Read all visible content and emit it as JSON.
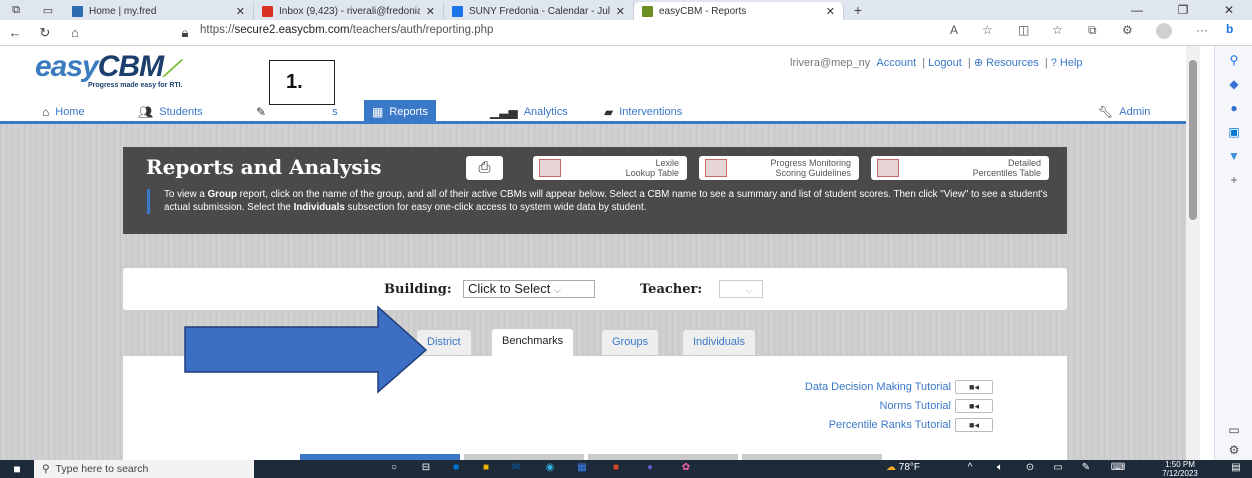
{
  "browser": {
    "tabs": [
      {
        "label": "Home | my.fred",
        "favicon_color": "#2b6cb0"
      },
      {
        "label": "Inbox (9,423) - riverali@fredonia",
        "favicon_color": "#d93025"
      },
      {
        "label": "SUNY Fredonia - Calendar - July",
        "favicon_color": "#1a73e8"
      },
      {
        "label": "easyCBM - Reports",
        "favicon_color": "#6b8e23",
        "active": true
      }
    ],
    "url_prefix": "https://",
    "url_domain": "secure2.easycbm.com",
    "url_path": "/teachers/auth/reporting.php"
  },
  "site": {
    "logo_easy": "easy",
    "logo_cbm": "CBM",
    "tagline": "Progress made easy for RTI.",
    "annotation": "1.",
    "user": "lrivera@mep_ny",
    "links": [
      "Account",
      "Logout",
      "Resources",
      "Help"
    ],
    "nav": [
      {
        "label": "Home",
        "icon": "home-icon"
      },
      {
        "label": "Students",
        "icon": "users-icon"
      },
      {
        "label": "s",
        "icon": "pencil-icon"
      },
      {
        "label": "Reports",
        "icon": "chart-icon",
        "active": true
      },
      {
        "label": "Analytics",
        "icon": "bar-chart-icon"
      },
      {
        "label": "Interventions",
        "icon": "book-icon"
      },
      {
        "label": "Admin",
        "icon": "wrench-icon"
      }
    ]
  },
  "reports": {
    "title": "Reports and Analysis",
    "buttons": [
      {
        "line1": "Lexile",
        "line2": "Lookup Table"
      },
      {
        "line1": "Progress Monitoring",
        "line2": "Scoring Guidelines"
      },
      {
        "line1": "Detailed",
        "line2": "Percentiles Table"
      }
    ],
    "desc_1": "To view a ",
    "desc_b1": "Group",
    "desc_2": " report, click on the name of the group, and all of their active CBMs will appear below. Select a CBM name to see a summary and list of student scores. Then click \"View\" to see a student's actual submission. Select the ",
    "desc_b2": "Individuals",
    "desc_3": " subsection for easy one-click access to system wide data by student."
  },
  "filters": {
    "building_label": "Building:",
    "building_value": "Click to Select",
    "teacher_label": "Teacher:",
    "teacher_value": ""
  },
  "tabs": [
    "District",
    "Benchmarks",
    "Groups",
    "Individuals"
  ],
  "tutorials": [
    "Data Decision Making Tutorial",
    "Norms Tutorial",
    "Percentile Ranks Tutorial"
  ],
  "taskbar": {
    "search_placeholder": "Type here to search",
    "weather": "78°F",
    "time": "1:50 PM",
    "date": "7/12/2023"
  },
  "colors": {
    "accent": "#3a78c8",
    "arrow": "#3c6fc4"
  }
}
